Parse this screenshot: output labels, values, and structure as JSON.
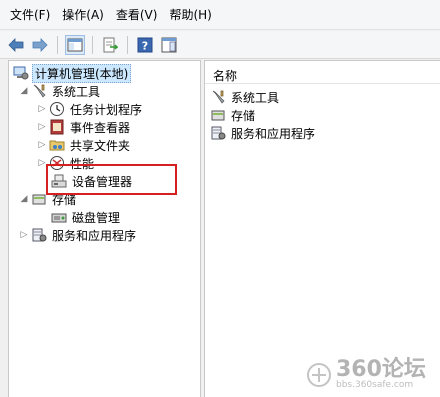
{
  "menubar": {
    "items": [
      "文件(F)",
      "操作(A)",
      "查看(V)",
      "帮助(H)"
    ]
  },
  "toolbar": {
    "buttons": [
      "back-icon",
      "forward-icon",
      "show-hide-tree-icon",
      "export-list-icon",
      "help-icon",
      "properties-icon"
    ]
  },
  "tree": {
    "root": "计算机管理(本地)",
    "system_tools": "系统工具",
    "task_scheduler": "任务计划程序",
    "event_viewer": "事件查看器",
    "shared_folders": "共享文件夹",
    "performance": "性能",
    "device_manager": "设备管理器",
    "storage": "存储",
    "disk_management": "磁盘管理",
    "services_apps": "服务和应用程序"
  },
  "list": {
    "column_name": "名称",
    "items": [
      "系统工具",
      "存储",
      "服务和应用程序"
    ]
  },
  "watermark": {
    "logo": "360论坛",
    "url": "bbs.360safe.com"
  }
}
